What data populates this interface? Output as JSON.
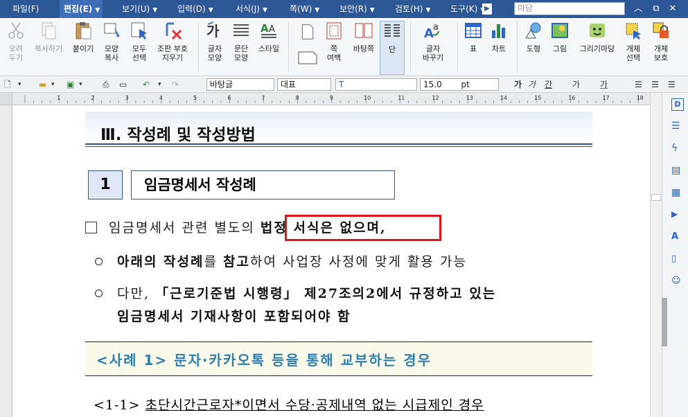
{
  "menubar": {
    "items": [
      {
        "label": "파일(F)"
      },
      {
        "label": "편집(E)"
      },
      {
        "label": "보기(U)"
      },
      {
        "label": "입력(D)"
      },
      {
        "label": "서식(J)"
      },
      {
        "label": "쪽(W)"
      },
      {
        "label": "보안(R)"
      },
      {
        "label": "검토(H)"
      },
      {
        "label": "도구(K)"
      }
    ],
    "search_placeholder": "마당"
  },
  "ribbon": {
    "buttons": [
      {
        "label": "오려\n두기",
        "icon": "scissors-icon"
      },
      {
        "label": "복사하기",
        "icon": "copy-icon"
      },
      {
        "label": "붙이기",
        "icon": "paste-icon"
      },
      {
        "label": "모양\n복사",
        "icon": "format-painter-icon"
      },
      {
        "label": "모두\n선택",
        "icon": "select-all-icon"
      },
      {
        "label": "조판 부호\n지우기",
        "icon": "clear-format-icon"
      },
      {
        "label": "글자\n모양",
        "icon": "char-shape-icon"
      },
      {
        "label": "문단\n모양",
        "icon": "para-shape-icon"
      },
      {
        "label": "스타일",
        "icon": "style-icon"
      },
      {
        "label": "쪽\n여백",
        "icon": "page-margin-icon"
      },
      {
        "label": "바탕쪽",
        "icon": "master-page-icon"
      },
      {
        "label": "단",
        "icon": "columns-icon"
      },
      {
        "label": "글자\n바꾸기",
        "icon": "char-replace-icon"
      },
      {
        "label": "표",
        "icon": "table-icon"
      },
      {
        "label": "차트",
        "icon": "chart-icon"
      },
      {
        "label": "도형",
        "icon": "shape-icon"
      },
      {
        "label": "그림",
        "icon": "picture-icon"
      },
      {
        "label": "그리기마당",
        "icon": "drawing-gallery-icon"
      },
      {
        "label": "개체\n선택",
        "icon": "object-select-icon"
      },
      {
        "label": "개체\n보호",
        "icon": "object-protect-icon"
      }
    ]
  },
  "toolbar2": {
    "style_value": "바탕글",
    "font_kind": "대표",
    "font_size": "15.0",
    "font_unit": "pt",
    "bold": "가",
    "italic": "가",
    "underline": "간",
    "strike": "가",
    "color_char": "가"
  },
  "ruler": {
    "ticks": [
      "1",
      "2",
      "3",
      "4",
      "5",
      "6",
      "7",
      "8",
      "9",
      "10",
      "11",
      "12",
      "13",
      "14",
      "15",
      "16",
      "17",
      "18"
    ]
  },
  "document": {
    "section_title": "Ⅲ. 작성례 및 작성방법",
    "num": "1",
    "heading": "임금명세서 작성례",
    "line1_pre": "임금명세서 관련 별도의 ",
    "line1_bold": "법정 서식은 없으며,",
    "line2_bold1": "아래의 작성례",
    "line2_mid": "를 ",
    "line2_bold2": "참고",
    "line2_rest": "하여 사업장 사정에 맞게 활용 가능",
    "line3_pre": "다만, ",
    "line3_bold": "「근로기준법 시행령」 제27조의2에서 규정하고 있는",
    "line4_bold": "임금명세서 기재사항이 포함되어야 함",
    "case_text": "<사례 1> 문자·카카오톡 등을 통해 교부하는 경우",
    "last_pre": "<1-1> ",
    "last_underlined": "초단시간근로자*이면서 수당·공제내역 없는 시급제인 경우"
  },
  "colors": {
    "menubar": "#2b5797",
    "highlight": "#e0141a",
    "case_text": "#2d7fb2",
    "border": "#34549c"
  }
}
